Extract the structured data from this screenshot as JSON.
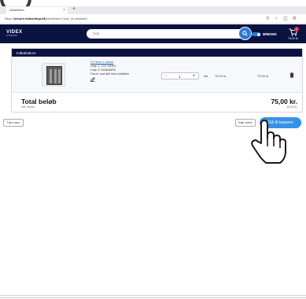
{
  "browser": {
    "tab_title": "Indkøbskurv",
    "new_tab": "+",
    "url_prefix": "https://",
    "url_domain": "secure.videoshop.dk",
    "url_path": "/kunde/kurv?unic_id=basketid"
  },
  "header": {
    "logo": "VIDEX",
    "logo_sub": "DANMARK",
    "search_placeholder": "Søg ...",
    "moms_label": "M/MOMS",
    "cart_count": "1",
    "cart_total": "75,00 kr."
  },
  "basket": {
    "title": "Indkøbskurv",
    "item": {
      "name": "VX 9mm x 18mm",
      "line1": "Linje 1: 17H VIDEX",
      "line2": "Linje 2: DANMARK",
      "note": "Farve: sort alt/i med indfatnin",
      "quantity": "1",
      "unit": "stk.",
      "price": "75,00 kr.",
      "line_total": "75,00 kr."
    },
    "total_label": "Total beløb",
    "total_sub": "inkl. moms",
    "total_amount": "75,00 kr.",
    "total_excl": "60,00 kr."
  },
  "actions": {
    "clear_label": "Tøm kurv",
    "more_label": "Køb mere",
    "checkout_label": "Gå til kassen"
  }
}
